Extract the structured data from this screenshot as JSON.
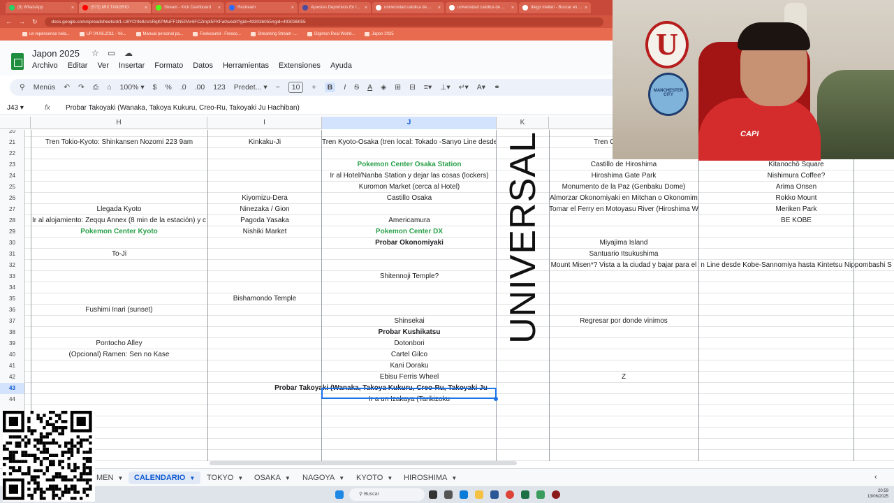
{
  "browser": {
    "tabs": [
      {
        "label": "(8) WhatsApp",
        "color": "#25d366"
      },
      {
        "label": "(573) MIX TANGRIO",
        "color": "#ff0000"
      },
      {
        "label": "Stream - Kick Dashboard",
        "color": "#53fc18"
      },
      {
        "label": "Restream",
        "color": "#2d6bff"
      },
      {
        "label": "Ajuestes Deportivos En I...",
        "color": "#4b4b9f"
      },
      {
        "label": "universidad catolica de ...",
        "color": "#ffffff"
      },
      {
        "label": "universidad catolica de ...",
        "color": "#ffffff"
      },
      {
        "label": "diego melian - Buscar en ...",
        "color": "#ffffff"
      }
    ],
    "url": "docs.google.com/spreadsheets/d/1-U8YChfe8cVsRqKPMuFF1NEPAHiFCZmpI5FKFa0s/edit?gid=493036055#gid=493036055",
    "bookmarks": [
      "un repensence nela...",
      "UP 04.06.2011 - Vo...",
      "Manual personal pa...",
      "Feeksound - Freeco...",
      "Streaming Stream -...",
      "Digimon Real World...",
      "Japon 2025"
    ]
  },
  "doc": {
    "title": "Japon 2025",
    "menu": [
      "Archivo",
      "Editar",
      "Ver",
      "Insertar",
      "Formato",
      "Datos",
      "Herramientas",
      "Extensiones",
      "Ayuda"
    ]
  },
  "toolbar": {
    "menus_label": "Menús",
    "zoom": "100%",
    "currency": "$",
    "percent": "%",
    "decimals_less": ".0",
    "decimals_more": ".00",
    "number_format": "123",
    "font": "Predet...",
    "minus": "−",
    "font_size": "10",
    "plus": "+",
    "bold": "B",
    "italic": "I",
    "strike": "S",
    "text_color": "A"
  },
  "formula_bar": {
    "cell_ref": "J43",
    "fx": "fx",
    "content": "Probar Takoyaki (Wanaka, Takoya Kukuru, Creo-Ru, Takoyaki Ju Hachiban)"
  },
  "columns": [
    {
      "label": "H",
      "selected": false
    },
    {
      "label": "I",
      "selected": false
    },
    {
      "label": "J",
      "selected": true
    },
    {
      "label": "K",
      "selected": false
    }
  ],
  "vertical_banner": "UNIVERSAL",
  "rows": [
    {
      "n": "20",
      "H": "",
      "I": "",
      "J": "",
      "L": "",
      "M": ""
    },
    {
      "n": "21",
      "H": "Tren Tokio-Kyoto: Shinkansen Nozomi 223 9am",
      "I": "Kinkaku-Ji",
      "J": "Tren Kyoto-Osaka (tren local: Tokado -Sanyo Line desde",
      "L": "Tren Osaka Hiroshi",
      "M": ""
    },
    {
      "n": "22",
      "H": "",
      "I": "",
      "J": "",
      "L": "",
      "M": "Sannomiya"
    },
    {
      "n": "23",
      "H": "",
      "I": "",
      "J": "Pokemon Center Osaka Station",
      "L": "Castillo de Hiroshima",
      "M": "Kitanochō Square"
    },
    {
      "n": "24",
      "H": "",
      "I": "",
      "J": "Ir al Hotel/Nanba Station y dejar las cosas (lockers)",
      "L": "Hiroshima Gate Park",
      "M": "Nishimura Coffee?"
    },
    {
      "n": "25",
      "H": "",
      "I": "",
      "J": "Kuromon Market (cerca al Hotel)",
      "L": "Monumento de la Paz (Genbaku Dome)",
      "M": "Arima Onsen"
    },
    {
      "n": "26",
      "H": "",
      "I": "Kiyomizu-Dera",
      "J": "Castillo Osaka",
      "L": "Almorzar Okonomiyaki en Mitchan o Okonomim",
      "M": "Rokko Mount"
    },
    {
      "n": "27",
      "H": "Llegada Kyoto",
      "I": "Ninezaka / Gion",
      "J": "",
      "L": "Tomar el Ferry en Motoyasu River (Hiroshima W",
      "M": "Meriken Park"
    },
    {
      "n": "28",
      "H": "Ir al alojamiento: Zeqqu Annex (8 min de la estación) y c",
      "I": "Pagoda Yasaka",
      "J": "Americamura",
      "L": "",
      "M": "BE KOBE"
    },
    {
      "n": "29",
      "H": "Pokemon Center Kyoto",
      "I": "Nishiki Market",
      "J": "Pokemon Center DX",
      "L": "",
      "M": ""
    },
    {
      "n": "30",
      "H": "",
      "I": "",
      "J": "Probar Okonomiyaki",
      "L": "Miyajima Island",
      "M": ""
    },
    {
      "n": "31",
      "H": "To-Ji",
      "I": "",
      "J": "",
      "L": "Santuario Itsukushima",
      "M": ""
    },
    {
      "n": "32",
      "H": "",
      "I": "",
      "J": "",
      "L": "Mount Misen*? Vista a la ciudad y bajar para el",
      "M": "n Line desde Kobe-Sannomiya hasta Kintetsu Nippombashi S"
    },
    {
      "n": "33",
      "H": "",
      "I": "",
      "J": "Shitennoji Temple?",
      "L": "",
      "M": ""
    },
    {
      "n": "34",
      "H": "",
      "I": "",
      "J": "",
      "L": "",
      "M": ""
    },
    {
      "n": "35",
      "H": "",
      "I": "Bishamondo Temple",
      "J": "",
      "L": "",
      "M": ""
    },
    {
      "n": "36",
      "H": "Fushimi Inari (sunset)",
      "I": "",
      "J": "",
      "L": "",
      "M": ""
    },
    {
      "n": "37",
      "H": "",
      "I": "",
      "J": "Shinsekai",
      "L": "Regresar por donde vinimos",
      "M": ""
    },
    {
      "n": "38",
      "H": "",
      "I": "",
      "J": "Probar Kushikatsu",
      "L": "",
      "M": ""
    },
    {
      "n": "39",
      "H": "Pontocho Alley",
      "I": "",
      "J": "Dotonbori",
      "L": "",
      "M": ""
    },
    {
      "n": "40",
      "H": "(Opcional) Ramen: Sen no Kase",
      "I": "",
      "J": "Cartel Gilco",
      "L": "",
      "M": ""
    },
    {
      "n": "41",
      "H": "",
      "I": "",
      "J": "Kani Doraku",
      "L": "",
      "M": ""
    },
    {
      "n": "42",
      "H": "",
      "I": "",
      "J": "Ebisu Ferris Wheel",
      "L": "Z",
      "M": ""
    },
    {
      "n": "43",
      "H": "",
      "I": "",
      "J": "Probar Takoyaki (Wanaka, Takoya Kukuru, Creo-Ru, Takoyaki Ju",
      "L": "",
      "M": ""
    },
    {
      "n": "44",
      "H": "",
      "I": "",
      "J": "Ir a un Izakaya (Tarikizoku",
      "L": "",
      "M": ""
    },
    {
      "n": "",
      "H": "",
      "I": "",
      "J": "",
      "L": "",
      "M": ""
    },
    {
      "n": "",
      "H": "",
      "I": "",
      "J": "",
      "L": "",
      "M": ""
    },
    {
      "n": "",
      "H": "",
      "I": "",
      "J": "",
      "L": "",
      "M": ""
    },
    {
      "n": "",
      "H": "",
      "I": "",
      "J": "",
      "L": "",
      "M": ""
    },
    {
      "n": "",
      "H": "",
      "I": "",
      "J": "",
      "L": "",
      "M": ""
    }
  ],
  "sheet_tabs": [
    {
      "label": "MEN",
      "active": false
    },
    {
      "label": "CALENDARIO",
      "active": true
    },
    {
      "label": "TOKYO",
      "active": false
    },
    {
      "label": "OSAKA",
      "active": false
    },
    {
      "label": "NAGOYA",
      "active": false
    },
    {
      "label": "KYOTO",
      "active": false
    },
    {
      "label": "HIROSHIMA",
      "active": false
    }
  ],
  "taskbar": {
    "search_label": "Buscar",
    "time": "20:59",
    "date": "13/06/2025"
  },
  "webcam": {
    "crest_letter": "U",
    "crest2_text": "MANCHESTER CITY",
    "shirt_text": "CAPI"
  },
  "colors": {
    "accent": "#0b57d0",
    "green_text": "#2ba14b",
    "browser_tab_bg": "#c8483a"
  }
}
